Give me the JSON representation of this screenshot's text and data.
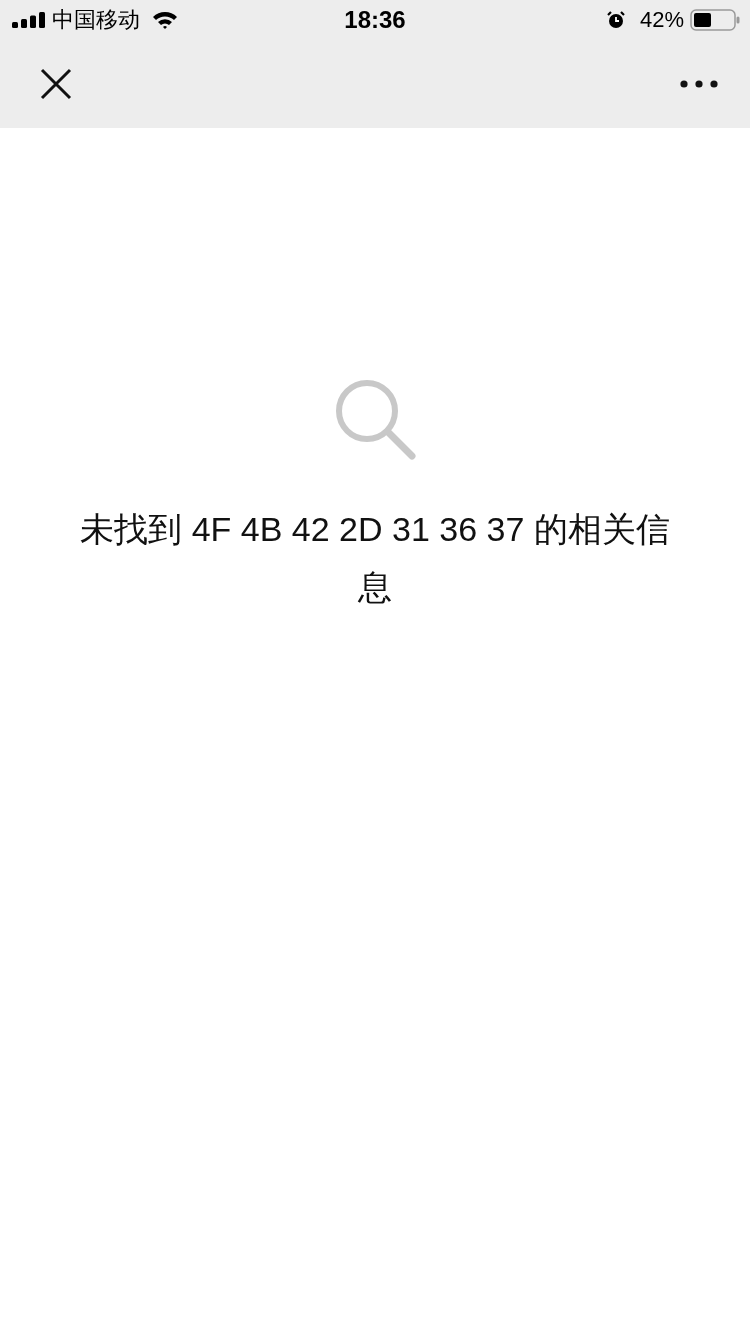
{
  "status_bar": {
    "carrier": "中国移动",
    "time": "18:36",
    "battery": "42%"
  },
  "message": "未找到 4F 4B 42 2D 31 36 37 的相关信息"
}
